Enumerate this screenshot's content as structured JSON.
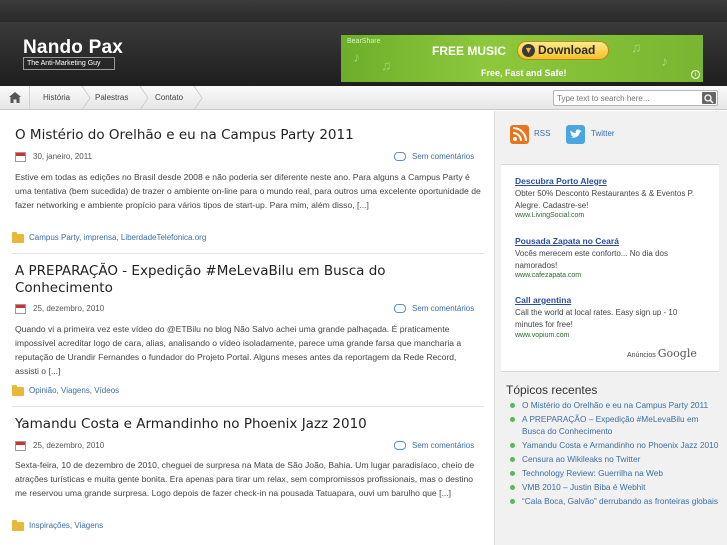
{
  "site": {
    "title": "Nando Pax",
    "tagline": "The Anti-Marketing Guy"
  },
  "banner": {
    "brand": "BearShare",
    "headline": "FREE MUSIC",
    "button": "Download",
    "sub": "Free, Fast and Safe!",
    "info": "i"
  },
  "nav": {
    "items": [
      {
        "label": "História"
      },
      {
        "label": "Palestras"
      },
      {
        "label": "Contato"
      }
    ]
  },
  "search": {
    "placeholder": "Type text to search here..."
  },
  "posts": [
    {
      "title": "O Mistério do Orelhão e eu na Campus Party 2011",
      "date": "30, janeiro, 2011",
      "comments": "Sem comentários",
      "excerpt": "Estive em todas as edições no Brasil desde 2008 e não poderia ser diferente neste ano. Para alguns a Campus Party é uma tentativa (bem sucedida) de trazer o ambiente on-line para o mundo real, para outros uma excelente oportunidade de fazer networking e ambiente propício para vários tipos de start-up. Para mim, além disso, [...]",
      "categories": "Campus Party, imprensa, LiberdadeTelefonica.org"
    },
    {
      "title": "A PREPARAÇÃO - Expedição #MeLevaBilu em Busca do Conhecimento",
      "date": "25, dezembro, 2010",
      "comments": "Sem comentários",
      "excerpt": "Quando vi a primeira vez este vídeo do @ETBilu no blog Não Salvo achei uma grande palhaçada. É praticamente impossível acreditar logo de cara, alias, analisando o vídeo isoladamente, parece uma grande farsa que mancharia a reputação de Urandir Fernandes o fundador do Projeto Portal. Alguns meses antes da reportagem da Rede Record, assisti o [...]",
      "categories": "Opinião, Viagens, Vídeos"
    },
    {
      "title": "Yamandu Costa e Armandinho no Phoenix Jazz 2010",
      "date": "25, dezembro, 2010",
      "comments": "Sem comentários",
      "excerpt": "Sexta-feira, 10 de dezembro de 2010, cheguei de surpresa na Mata de São João, Bahia. Um lugar paradisíaco, cheio de atrações turísticas e muita gente bonita. Era apenas para tirar um relax, sem compromissos profissionais, mas o destino me reservou uma grande surpresa. Logo depois de fazer check-in na pousada Tatuapara, ouvi um barulho que [...]",
      "categories": "Inspirações, Viagens"
    }
  ],
  "sidebar": {
    "rss": "RSS",
    "twitter": "Twitter",
    "ads": [
      {
        "title": "Descubra Porto Alegre",
        "text": "Obter 50% Desconto Restaurantes & & Eventos P. Alegre. Cadastre-se!",
        "url": "www.LivingSocial.com"
      },
      {
        "title": "Pousada Zapata no Ceará",
        "text": "Vocês merecem este conforto... No dia dos namorados!",
        "url": "www.cafezapata.com"
      },
      {
        "title": "Call argentina",
        "text": "Call the world at local rates. Easy sign up - 10 minutes for free!",
        "url": "www.vopium.com"
      }
    ],
    "ads_by": "Anúncios",
    "ads_google": "Google",
    "recent_title": "Tópicos recentes",
    "recent": [
      "O Mistério do Orelhão e eu na Campus Party 2011",
      "A PREPARAÇÃO – Expedição #MeLevaBilu em Busca do Conhecimento",
      "Yamandu Costa e Armandinho no Phoenix Jazz 2010",
      "Censura ao Wikileaks no Twitter",
      "Technology Review: Guerrilha na Web",
      "VMB 2010 – Justin Biba é Webhit",
      "“Cala Boca, Galvão” derrubando as fronteiras globais"
    ]
  },
  "colors": {
    "link": "#3a6ea5",
    "header": "#2a2a2a",
    "banner": "#8dc83c",
    "bullet": "#5ab85a"
  }
}
